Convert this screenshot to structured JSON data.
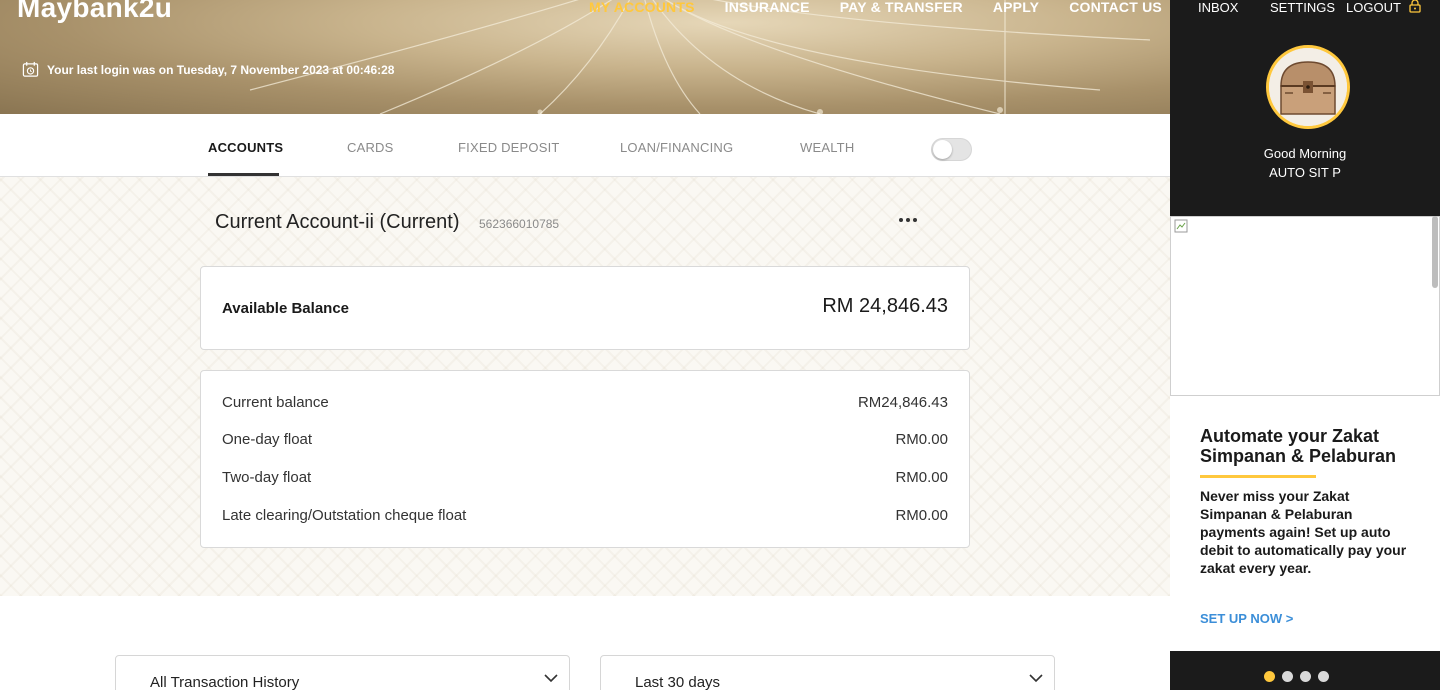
{
  "header": {
    "logo": "Maybank2u",
    "nav": [
      "MY ACCOUNTS",
      "INSURANCE",
      "PAY & TRANSFER",
      "APPLY",
      "CONTACT US"
    ],
    "active_nav": "MY ACCOUNTS",
    "last_login": "Your last login was on Tuesday, 7 November 2023 at 00:46:28"
  },
  "tabs": [
    "ACCOUNTS",
    "CARDS",
    "FIXED DEPOSIT",
    "LOAN/FINANCING",
    "WEALTH"
  ],
  "account": {
    "title": "Current Account-ii (Current)",
    "number": "562366010785",
    "more_icon": "more-horizontal-icon",
    "available_label": "Available Balance",
    "available_value": "RM 24,846.43",
    "details": [
      {
        "label": "Current balance",
        "value": "RM24,846.43"
      },
      {
        "label": "One-day float",
        "value": "RM0.00"
      },
      {
        "label": "Two-day float",
        "value": "RM0.00"
      },
      {
        "label": "Late clearing/Outstation cheque float",
        "value": "RM0.00"
      }
    ]
  },
  "filters": {
    "history": "All Transaction History",
    "period": "Last 30 days"
  },
  "user_panel": {
    "nav": [
      "INBOX",
      "SETTINGS",
      "LOGOUT"
    ],
    "greeting": "Good Morning",
    "name": "AUTO SIT P"
  },
  "promo": {
    "title": "Automate your Zakat Simpanan & Pelaburan",
    "body": "Never miss your Zakat Simpanan & Pelaburan payments again! Set up auto debit to automatically pay your zakat every year.",
    "cta": "SET UP NOW >"
  },
  "carousel_active_index": 0,
  "colors": {
    "accent": "#ffc83d",
    "link": "#3b8ed8",
    "panel_dark": "#1b1b1b"
  }
}
